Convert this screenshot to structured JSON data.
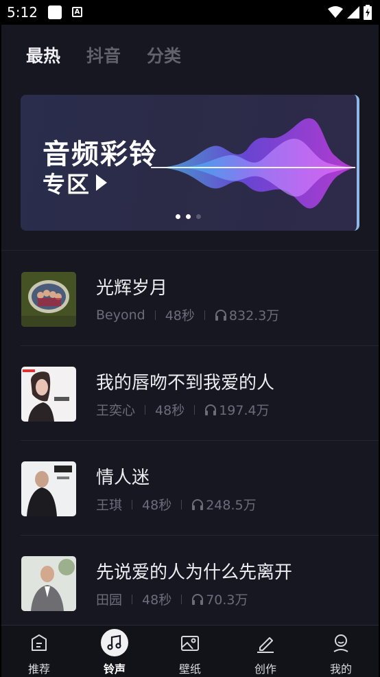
{
  "status_bar": {
    "time": "5:12",
    "a_icon_label": "A"
  },
  "tabs": [
    {
      "label": "最热",
      "active": true
    },
    {
      "label": "抖音",
      "active": false
    },
    {
      "label": "分类",
      "active": false
    }
  ],
  "banner": {
    "title": "音频彩铃",
    "subtitle": "专区",
    "page_count": 3,
    "active_page": 1,
    "colors": {
      "wave_pink": "#e040fb",
      "wave_blue": "#4fc3f7",
      "wave_purple": "#7c4dff"
    }
  },
  "songs": [
    {
      "title": "光辉岁月",
      "artist": "Beyond",
      "duration": "48秒",
      "plays": "832.3万",
      "cover_icon": "album-cover-group-icon"
    },
    {
      "title": "我的唇吻不到我爱的人",
      "artist": "王奕心",
      "duration": "48秒",
      "plays": "197.4万",
      "cover_icon": "album-cover-woman-icon"
    },
    {
      "title": "情人迷",
      "artist": "王琪",
      "duration": "48秒",
      "plays": "248.5万",
      "cover_icon": "album-cover-man-icon"
    },
    {
      "title": "先说爱的人为什么先离开",
      "artist": "田园",
      "duration": "48秒",
      "plays": "70.3万",
      "cover_icon": "album-cover-suit-man-icon"
    }
  ],
  "bottom_nav": [
    {
      "label": "推荐",
      "icon": "recommend-icon",
      "active": false
    },
    {
      "label": "铃声",
      "icon": "music-note-icon",
      "active": true
    },
    {
      "label": "壁纸",
      "icon": "wallpaper-image-icon",
      "active": false
    },
    {
      "label": "创作",
      "icon": "pencil-create-icon",
      "active": false
    },
    {
      "label": "我的",
      "icon": "profile-icon",
      "active": false
    }
  ],
  "colors": {
    "background": "#171721",
    "text_primary": "#ececf1",
    "text_secondary": "#6d6d7a",
    "tab_inactive": "#62626c"
  }
}
